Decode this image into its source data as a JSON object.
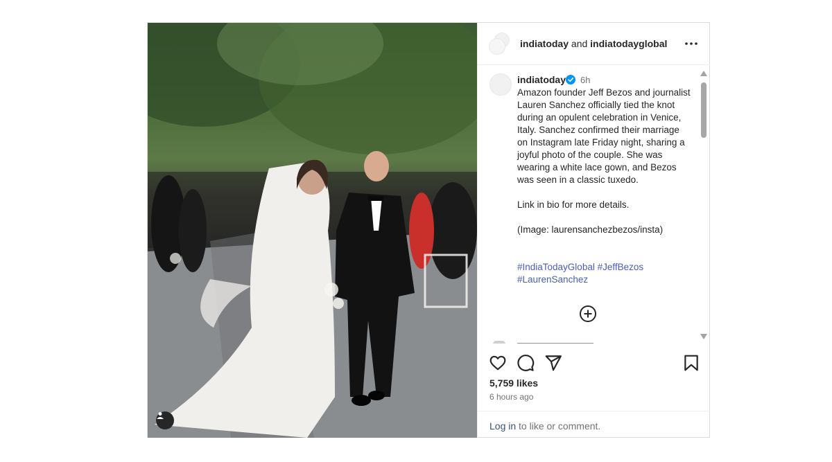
{
  "header": {
    "user1": "indiatoday",
    "conj": " and ",
    "user2": "indiatodayglobal"
  },
  "caption": {
    "username": "indiatoday",
    "time": "6h",
    "text": "Amazon founder Jeff Bezos and journalist Lauren Sanchez officially tied the knot during an opulent celebration in Venice, Italy. Sanchez confirmed their marriage on Instagram late Friday night, sharing a joyful photo of the couple. She was wearing a white lace gown, and Bezos was seen in a classic tuxedo.\n\nLink in bio for more details.\n\n(Image: laurensanchezbezos/insta)",
    "hashtags": [
      "#IndiaTodayGlobal",
      "#JeffBezos",
      "#LaurenSanchez"
    ]
  },
  "stats": {
    "likes": "5,759 likes",
    "time_ago": "6 hours ago"
  },
  "footer": {
    "login_link": "Log in",
    "login_rest": " to like or comment."
  },
  "colors": {
    "verified": "#0095f6",
    "link": "#385185",
    "hashtag": "#4a5db8"
  },
  "icons": [
    "more-options-icon",
    "verified-badge-icon",
    "add-comment-icon",
    "like-heart-icon",
    "comment-icon",
    "share-icon",
    "save-bookmark-icon",
    "user-tag-icon"
  ]
}
